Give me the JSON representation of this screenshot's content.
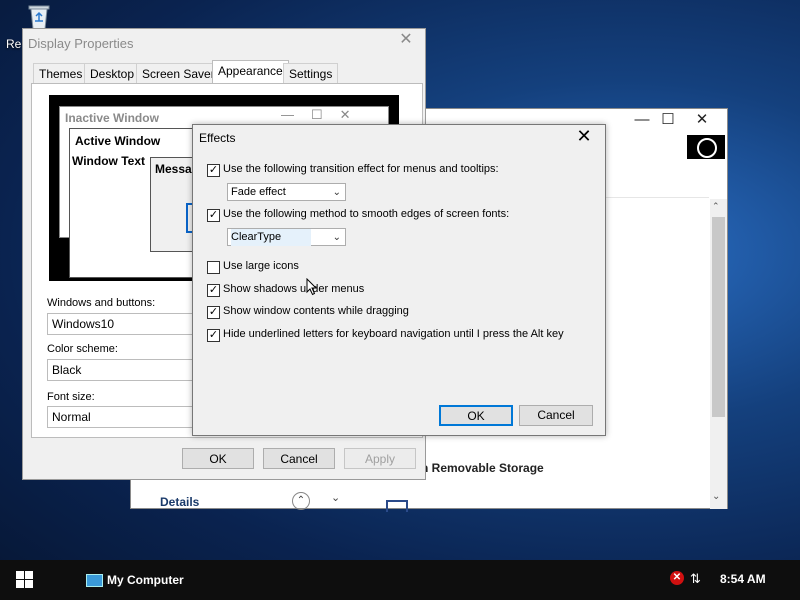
{
  "desktop": {
    "recycle_label": "Re"
  },
  "background_window": {
    "caption_min": "—",
    "caption_max": "☐",
    "caption_close": "✕",
    "section_text": "n Removable Storage",
    "details_label": "Details",
    "circle_glyph": "⌃",
    "chevron_glyph": "⌄",
    "scroll_up": "⌃",
    "scroll_down": "⌄"
  },
  "display_properties": {
    "title": "Display Properties",
    "close": "✕",
    "tabs": [
      "Themes",
      "Desktop",
      "Screen Saver",
      "Appearance",
      "Settings"
    ],
    "active_tab": "Appearance",
    "preview": {
      "inactive_title": "Inactive Window",
      "inactive_buttons": "—☐✕",
      "active_title": "Active Window",
      "window_text": "Window Text",
      "message_title": "Messa"
    },
    "windows_buttons_label": "Windows and buttons:",
    "windows_buttons_value": "Windows10",
    "color_scheme_label": "Color scheme:",
    "color_scheme_value": "Black",
    "font_size_label": "Font size:",
    "font_size_value": "Normal",
    "ok": "OK",
    "cancel": "Cancel",
    "apply": "Apply"
  },
  "effects_dialog": {
    "title": "Effects",
    "close": "✕",
    "options": [
      {
        "label": "Use the following transition effect for menus and tooltips:",
        "checked": true
      },
      {
        "label": "Use the following method to smooth edges of screen fonts:",
        "checked": true
      },
      {
        "label": "Use large icons",
        "checked": false
      },
      {
        "label": "Show shadows under menus",
        "checked": true
      },
      {
        "label": "Show window contents while dragging",
        "checked": true
      },
      {
        "label": "Hide underlined letters for keyboard navigation until I press the Alt key",
        "checked": true
      }
    ],
    "transition_effect": "Fade effect",
    "smoothing_method": "ClearType",
    "dropdown_chevron": "⌄",
    "check_glyph": "✓",
    "ok": "OK",
    "cancel": "Cancel"
  },
  "taskbar": {
    "task_label": "My Computer",
    "tray_error_glyph": "✕",
    "tray_network_glyph": "⇅",
    "clock": "8:54 AM"
  },
  "colors": {
    "accent": "#0078d7",
    "taskbar": "#0e0e0e"
  }
}
